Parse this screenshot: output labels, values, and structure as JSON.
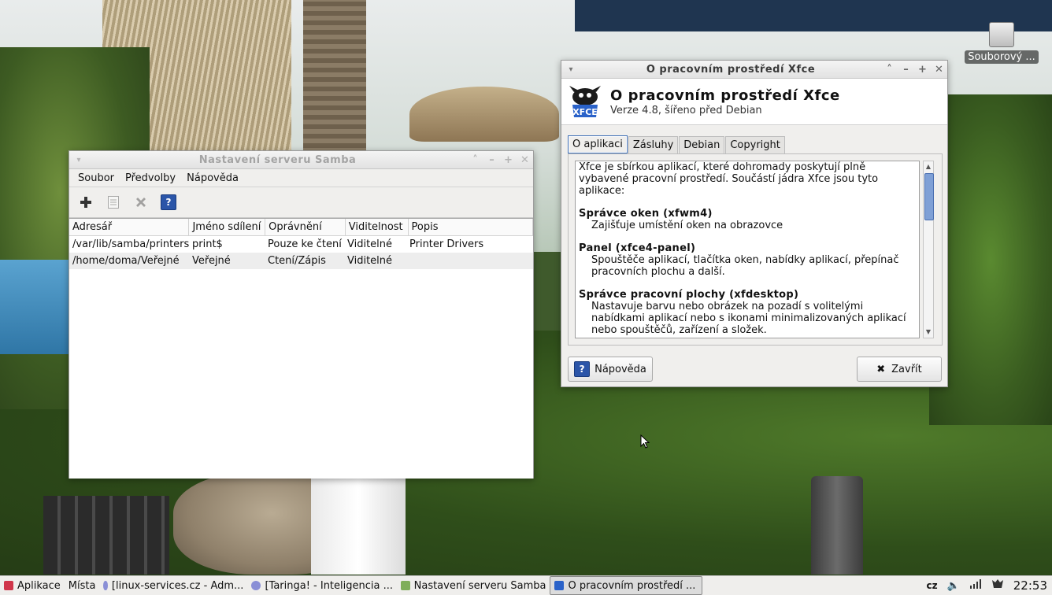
{
  "desktop": {
    "icon_label": "Souborový ..."
  },
  "samba": {
    "title": "Nastavení serveru Samba",
    "menu": [
      "Soubor",
      "Předvolby",
      "Nápověda"
    ],
    "toolbar_icons": [
      "add-icon",
      "properties-icon",
      "delete-icon",
      "help-icon"
    ],
    "columns": [
      "Adresář",
      "Jméno sdílení",
      "Oprávnění",
      "Viditelnost",
      "Popis"
    ],
    "rows": [
      [
        "/var/lib/samba/printers",
        "print$",
        "Pouze ke čtení",
        "Viditelné",
        "Printer Drivers"
      ],
      [
        "/home/doma/Veřejné",
        "Veřejné",
        "Čtení/Zápis",
        "Viditelné",
        ""
      ]
    ]
  },
  "about": {
    "window_title": "O pracovním prostředí Xfce",
    "heading": "O pracovním prostředí Xfce",
    "subheading": "Verze 4.8, šířeno před Debian",
    "tabs": [
      "O aplikaci",
      "Zásluhy",
      "Debian",
      "Copyright"
    ],
    "intro": "Xfce je sbírkou aplikací, které dohromady poskytují plně vybavené pracovní prostředí. Součástí jádra Xfce jsou tyto aplikace:",
    "sections": [
      {
        "title": "Správce oken (xfwm4)",
        "desc": "Zajišťuje umístění oken na obrazovce"
      },
      {
        "title": "Panel (xfce4-panel)",
        "desc": "Spouštěče aplikací, tlačítka oken, nabídky aplikací, přepínač pracovních plochu a další."
      },
      {
        "title": "Správce pracovní plochy (xfdesktop)",
        "desc": "Nastavuje barvu nebo obrázek na pozadí s volitelými nabídkami aplikací nebo s ikonami minimalizovaných aplikací nebo spouštěčů, zařízení a složek."
      }
    ],
    "help_button": "Nápověda",
    "close_button": "Zavřít"
  },
  "taskbar": {
    "apps_menu": "Aplikace",
    "places_menu": "Místa",
    "tasks": [
      "[linux-services.cz - Adm...",
      "[Taringa! - Inteligencia ...",
      "Nastavení serveru Samba",
      "O pracovním prostředí ..."
    ],
    "keyboard_layout": "cz",
    "clock": "22:53"
  },
  "colors": {
    "help_blue": "#2b55a8",
    "active_tab_border": "#3f6fb6",
    "apps_menu_icon": "#d0354a"
  }
}
